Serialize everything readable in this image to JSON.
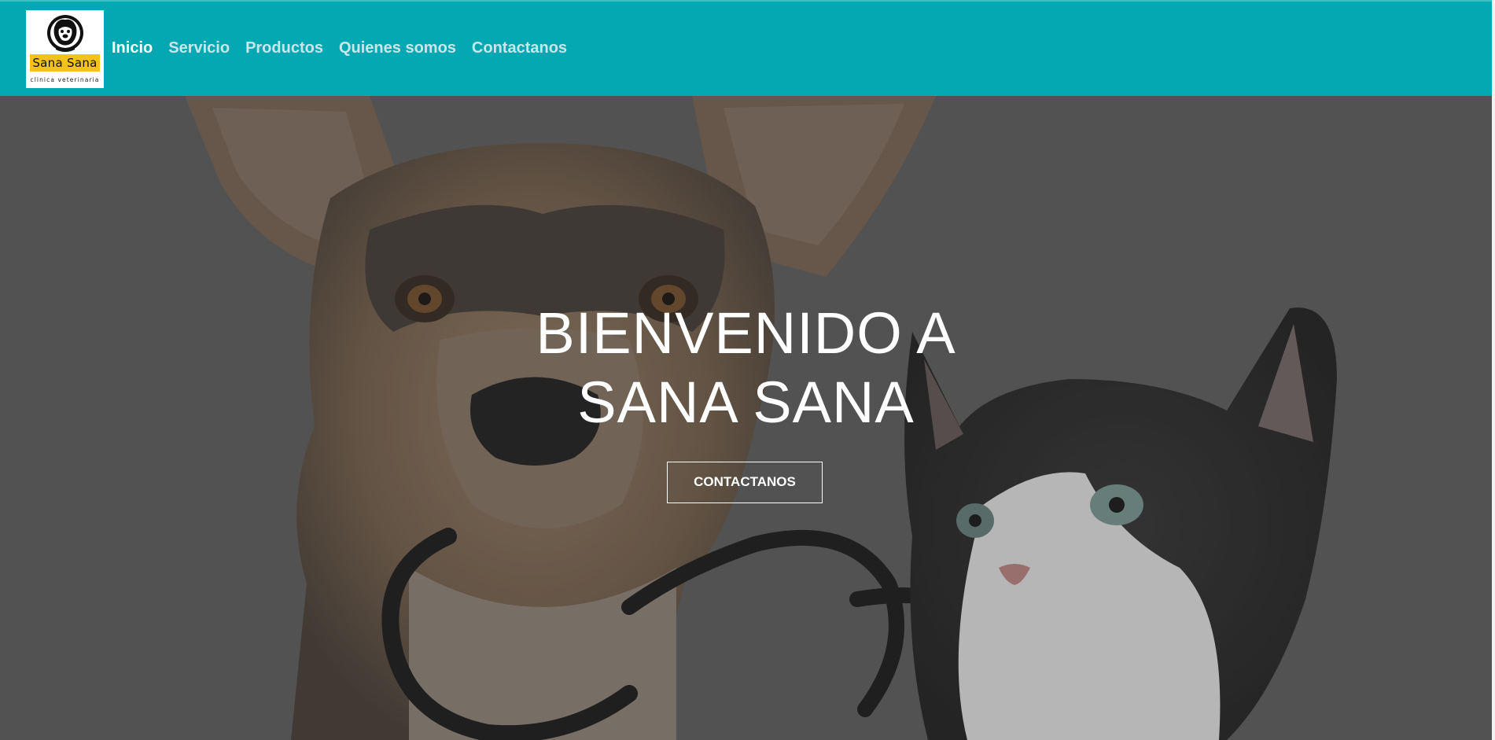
{
  "brand": {
    "logo_word": "Sana Sana",
    "logo_sub": "clinica veterinaria"
  },
  "nav": {
    "items": [
      {
        "label": "Inicio",
        "active": true
      },
      {
        "label": "Servicio",
        "active": false
      },
      {
        "label": "Productos",
        "active": false
      },
      {
        "label": "Quienes somos",
        "active": false
      },
      {
        "label": "Contactanos",
        "active": false
      }
    ]
  },
  "hero": {
    "title_line1": "BIENVENIDO A",
    "title_line2": "SANA SANA",
    "button_label": "CONTACTANOS"
  },
  "colors": {
    "navbar": "#04a8b2",
    "logo_accent": "#f4c21d",
    "hero_overlay": "#555555",
    "text": "#ffffff"
  }
}
